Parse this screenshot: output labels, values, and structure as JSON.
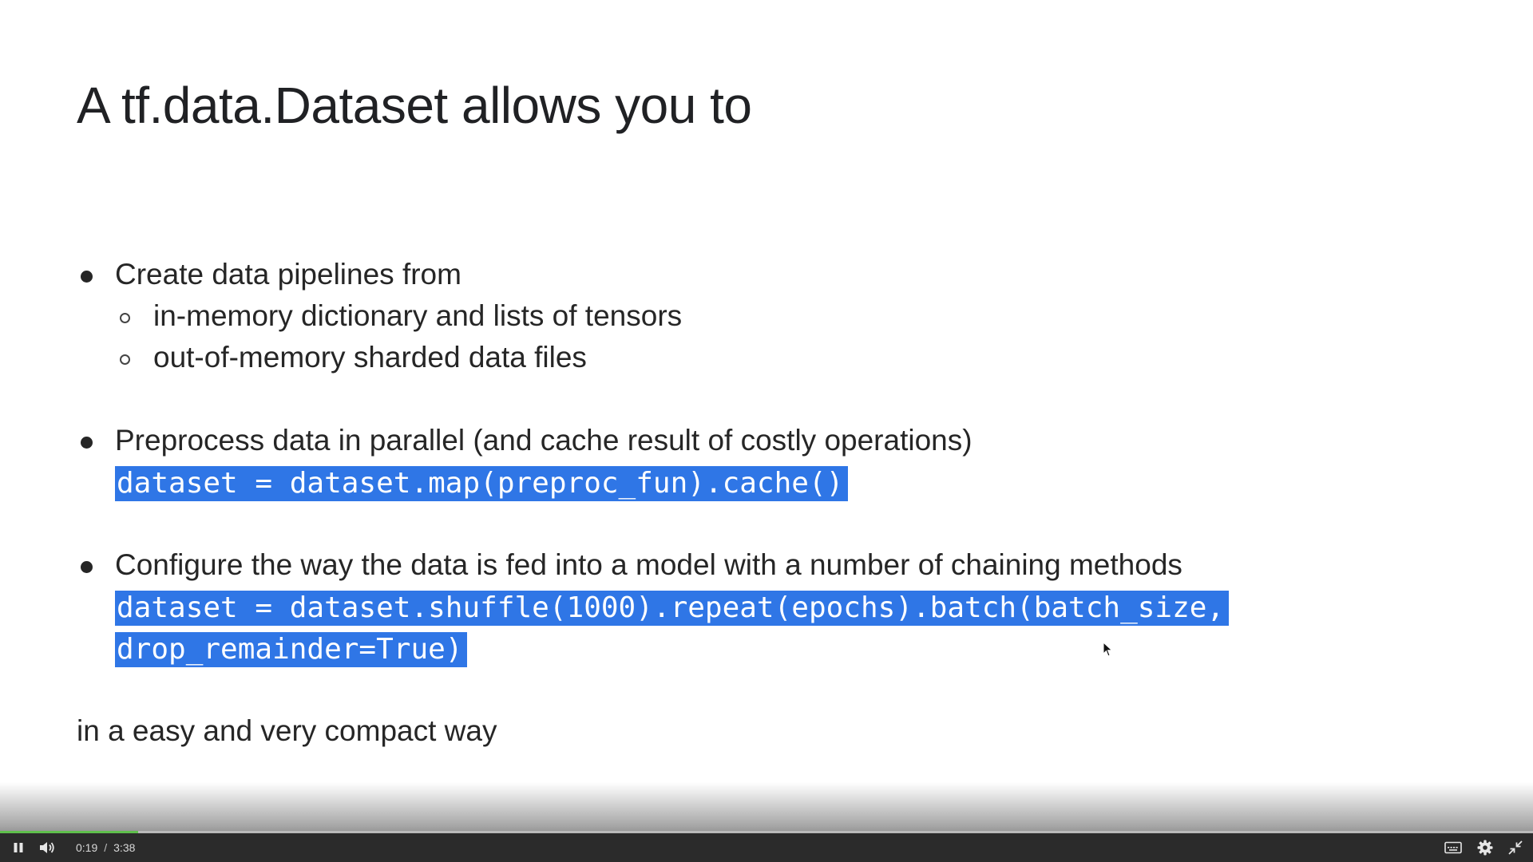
{
  "slide": {
    "title": "A tf.data.Dataset allows you to",
    "bullets": [
      {
        "text": "Create data pipelines from",
        "subitems": [
          "in-memory dictionary and lists of tensors",
          "out-of-memory sharded data files"
        ]
      },
      {
        "text": "Preprocess data in parallel (and cache result of costly operations)",
        "code": [
          "dataset = dataset.map(preproc_fun).cache()"
        ]
      },
      {
        "text": "Configure the way the data is fed into a model with a number of chaining methods",
        "code": [
          "dataset = dataset.shuffle(1000).repeat(epochs).batch(batch_size,",
          "drop_remainder=True)"
        ]
      }
    ],
    "closing": "in a easy and very compact way",
    "highlight_color": "#2f76e6"
  },
  "player": {
    "current_time": "0:19",
    "time_separator": "/",
    "duration": "3:38",
    "progress": 0.09,
    "progress_color": "#5fbf4c",
    "icons": {
      "play_pause": "pause-icon",
      "volume": "volume-icon",
      "captions": "captions-icon",
      "settings": "settings-icon",
      "fullscreen": "exit-fullscreen-icon"
    }
  }
}
